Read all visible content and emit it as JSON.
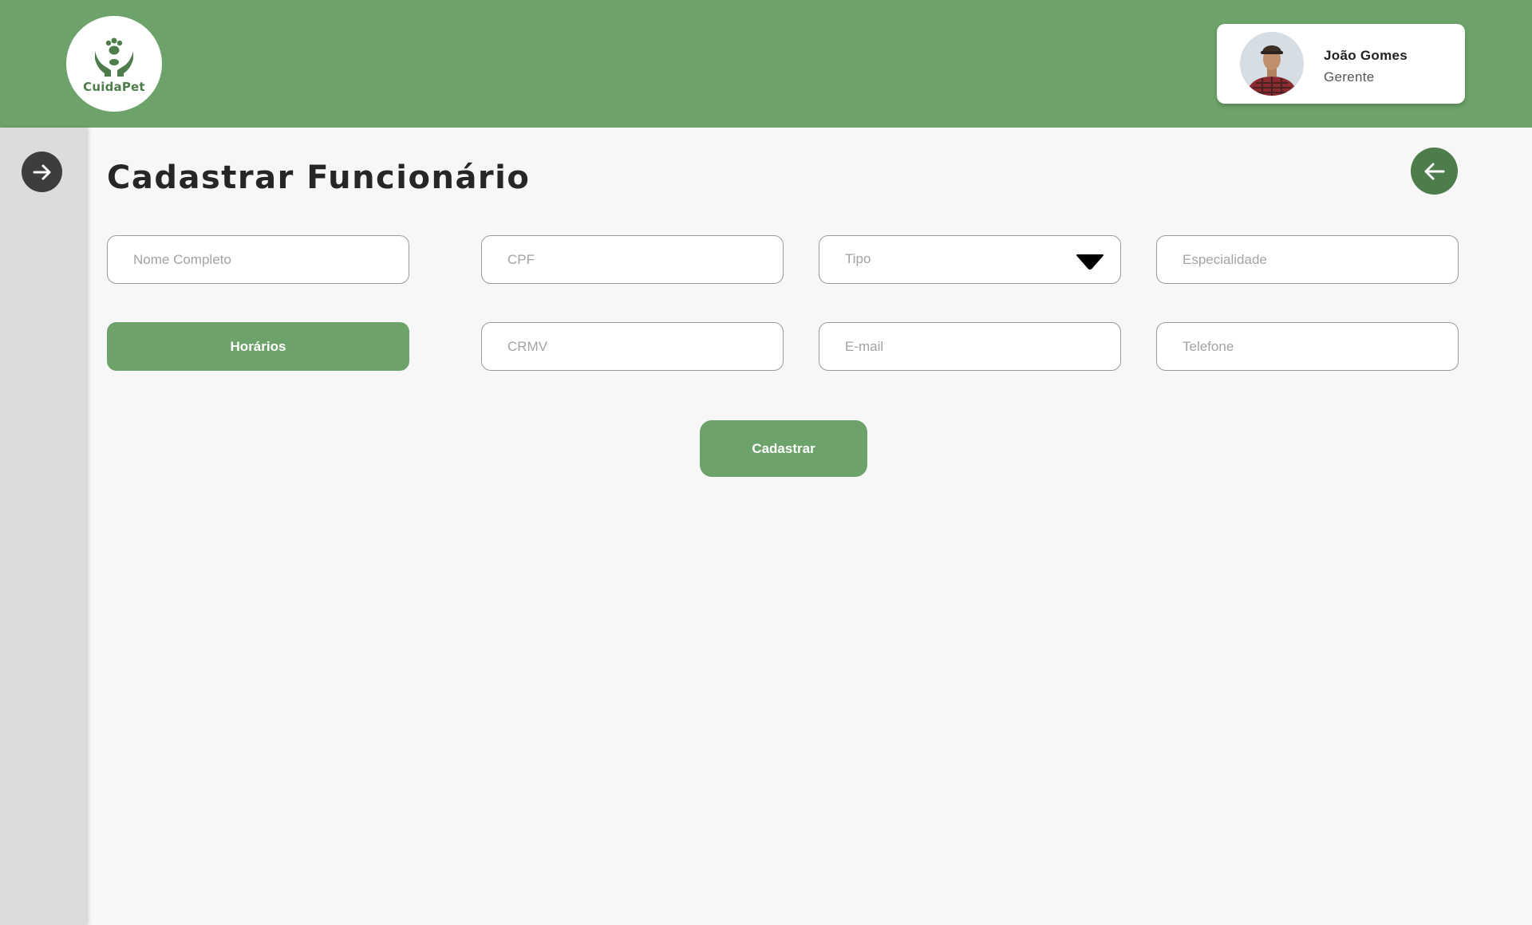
{
  "header": {
    "logo_text": "CuidaPet",
    "user": {
      "name": "João Gomes",
      "role": "Gerente"
    }
  },
  "sidebar": {
    "toggle_icon": "arrow-right-icon"
  },
  "main": {
    "title": "Cadastrar Funcionário",
    "back_icon": "arrow-left-icon",
    "form": {
      "nome_placeholder": "Nome Completo",
      "cpf_placeholder": "CPF",
      "tipo_value": "Tipo",
      "especialidade_placeholder": "Especialidade",
      "horarios_label": "Horários",
      "crmv_placeholder": "CRMV",
      "email_placeholder": "E-mail",
      "telefone_placeholder": "Telefone",
      "submit_label": "Cadastrar"
    }
  },
  "colors": {
    "brand_green": "#6da36a",
    "dark_green": "#4e7d4c",
    "sidebar_bg": "#dcdcdc",
    "page_bg": "#f7f7f7"
  }
}
